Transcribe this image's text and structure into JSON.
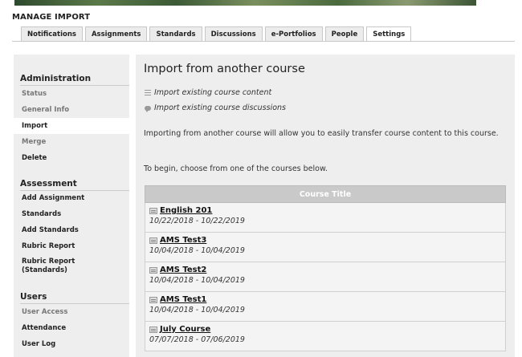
{
  "header": {
    "title": "MANAGE IMPORT"
  },
  "tabs": [
    {
      "label": "Notifications",
      "active": false
    },
    {
      "label": "Assignments",
      "active": false
    },
    {
      "label": "Standards",
      "active": false
    },
    {
      "label": "Discussions",
      "active": false
    },
    {
      "label": "e-Portfolios",
      "active": false
    },
    {
      "label": "People",
      "active": false
    },
    {
      "label": "Settings",
      "active": true
    }
  ],
  "sidebar": {
    "administration": {
      "heading": "Administration",
      "items": [
        {
          "label": "Status",
          "state": "muted"
        },
        {
          "label": "General Info",
          "state": "muted"
        },
        {
          "label": "Import",
          "state": "active"
        },
        {
          "label": "Merge",
          "state": "muted"
        },
        {
          "label": "Delete",
          "state": "normal"
        }
      ]
    },
    "assessment": {
      "heading": "Assessment",
      "items": [
        {
          "label": "Add Assignment"
        },
        {
          "label": "Standards"
        },
        {
          "label": "Add Standards"
        },
        {
          "label": "Rubric Report"
        },
        {
          "label": "Rubric Report\n(Standards)"
        }
      ]
    },
    "users": {
      "heading": "Users",
      "items": [
        {
          "label": "User Access",
          "state": "muted"
        },
        {
          "label": "Attendance",
          "state": "normal"
        },
        {
          "label": "User Log",
          "state": "normal"
        }
      ]
    }
  },
  "main": {
    "title": "Import from another course",
    "options": [
      {
        "label": "Import existing course content",
        "icon": "list-icon"
      },
      {
        "label": "Import existing course discussions",
        "icon": "chat-bubble-icon"
      }
    ],
    "intro": "Importing from another course will allow you to easily transfer course content to this course.",
    "instruction": "To begin, choose from one of the courses below.",
    "table": {
      "column_header": "Course Title",
      "rows": [
        {
          "title": "English 201",
          "dates": "10/22/2018 - 10/22/2019"
        },
        {
          "title": "AMS Test3",
          "dates": "10/04/2018 - 10/04/2019"
        },
        {
          "title": "AMS Test2",
          "dates": "10/04/2018 - 10/04/2019"
        },
        {
          "title": "AMS Test1",
          "dates": "10/04/2018 - 10/04/2019"
        },
        {
          "title": "July Course",
          "dates": "07/07/2018 - 07/06/2019"
        }
      ]
    }
  }
}
